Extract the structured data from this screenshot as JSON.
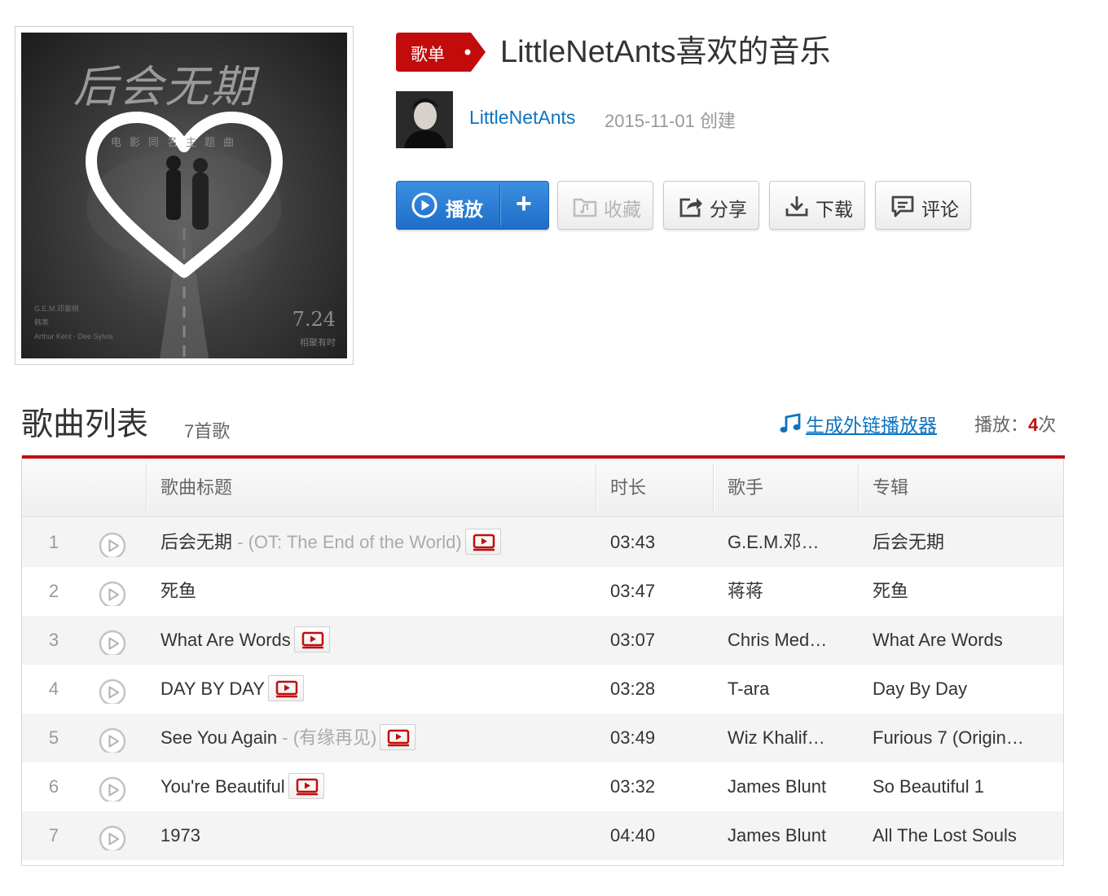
{
  "cover": {
    "title_art": "后会无期",
    "subtitle_art": "电影同名主题曲",
    "date_art": "7.24",
    "tag_art": "相聚有时",
    "credits_art": [
      "G.E.M.邓紫棋",
      "韩寒",
      "Arthur Kent · Dee Sylvia"
    ]
  },
  "header": {
    "badge": "歌单",
    "title": "LittleNetAnts喜欢的音乐",
    "creator": "LittleNetAnts",
    "created_date": "2015-11-01",
    "created_suffix": "创建"
  },
  "actions": {
    "play": "播放",
    "add": "+",
    "favorite": "收藏",
    "share": "分享",
    "download": "下载",
    "comment": "评论"
  },
  "tracklist": {
    "title": "歌曲列表",
    "count": "7首歌",
    "external_player_link": "生成外链播放器",
    "play_count_label": "播放：",
    "play_count_value": "4",
    "play_count_unit": "次",
    "columns": [
      "歌曲标题",
      "时长",
      "歌手",
      "专辑"
    ],
    "rows": [
      {
        "num": "1",
        "title": "后会无期",
        "alias": " - (OT: The End of the World)",
        "mv": true,
        "duration": "03:43",
        "artist": "G.E.M.邓…",
        "album": "后会无期"
      },
      {
        "num": "2",
        "title": "死鱼",
        "alias": "",
        "mv": false,
        "duration": "03:47",
        "artist": "蒋蒋",
        "album": "死鱼"
      },
      {
        "num": "3",
        "title": "What Are Words",
        "alias": "",
        "mv": true,
        "duration": "03:07",
        "artist": "Chris Med…",
        "album": "What Are Words"
      },
      {
        "num": "4",
        "title": "DAY BY DAY",
        "alias": "",
        "mv": true,
        "duration": "03:28",
        "artist": "T-ara",
        "album": "Day By Day"
      },
      {
        "num": "5",
        "title": "See You Again",
        "alias": " - (有缘再见)",
        "mv": true,
        "duration": "03:49",
        "artist": "Wiz Khalif…",
        "album": "Furious 7 (Origin…"
      },
      {
        "num": "6",
        "title": "You're Beautiful",
        "alias": "",
        "mv": true,
        "duration": "03:32",
        "artist": "James Blunt",
        "album": "So Beautiful 1"
      },
      {
        "num": "7",
        "title": "1973",
        "alias": "",
        "mv": false,
        "duration": "04:40",
        "artist": "James Blunt",
        "album": "All The Lost Souls"
      }
    ]
  },
  "colors": {
    "brand_red": "#c20c0c",
    "link_blue": "#0c73c2",
    "play_button_blue": "#2a7dd6"
  }
}
